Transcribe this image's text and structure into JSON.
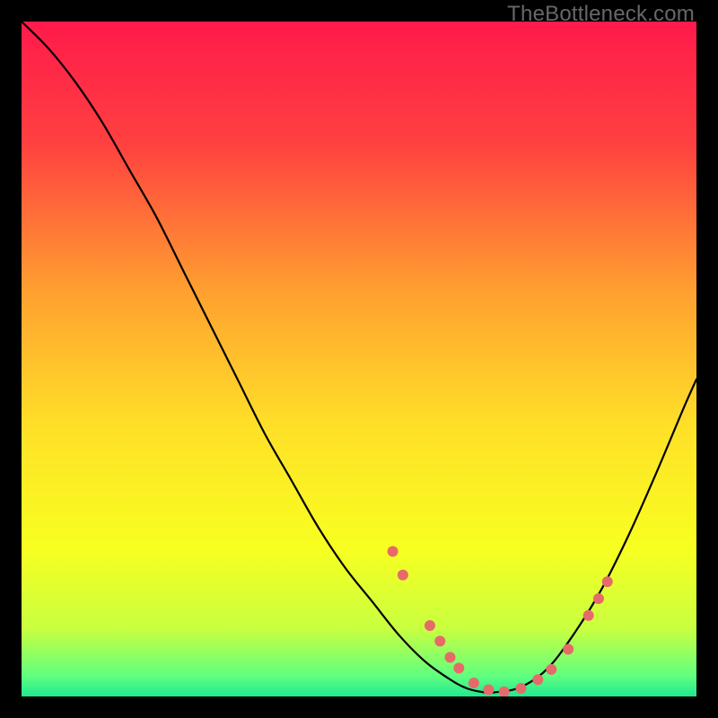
{
  "watermark": "TheBottleneck.com",
  "chart_data": {
    "type": "line",
    "title": "",
    "xlabel": "",
    "ylabel": "",
    "xlim": [
      0,
      100
    ],
    "ylim": [
      0,
      100
    ],
    "grid": false,
    "gradient_stops": [
      {
        "offset": 0,
        "color": "#ff1a4b"
      },
      {
        "offset": 0.18,
        "color": "#ff4040"
      },
      {
        "offset": 0.4,
        "color": "#ffa030"
      },
      {
        "offset": 0.6,
        "color": "#ffe028"
      },
      {
        "offset": 0.78,
        "color": "#f8ff20"
      },
      {
        "offset": 0.9,
        "color": "#c8ff40"
      },
      {
        "offset": 0.97,
        "color": "#60ff80"
      },
      {
        "offset": 1.0,
        "color": "#20e890"
      }
    ],
    "series": [
      {
        "name": "bottleneck-curve",
        "color": "#000000",
        "stroke_width": 2.2,
        "x": [
          0,
          4,
          8,
          12,
          16,
          20,
          24,
          28,
          32,
          36,
          40,
          44,
          48,
          52,
          56,
          60,
          64,
          66,
          68,
          70,
          74,
          78,
          82,
          86,
          90,
          94,
          98,
          100
        ],
        "y": [
          100,
          96,
          91,
          85,
          78,
          71,
          63,
          55,
          47,
          39,
          32,
          25,
          19,
          14,
          9,
          5,
          2.2,
          1.2,
          0.7,
          0.6,
          1.4,
          4.2,
          9.5,
          16,
          24,
          33,
          42.5,
          47
        ]
      }
    ],
    "markers": {
      "name": "curve-markers",
      "color": "#e76a6a",
      "radius": 6,
      "points": [
        {
          "x": 55.0,
          "y": 21.5
        },
        {
          "x": 56.5,
          "y": 18.0
        },
        {
          "x": 60.5,
          "y": 10.5
        },
        {
          "x": 62.0,
          "y": 8.2
        },
        {
          "x": 63.5,
          "y": 5.8
        },
        {
          "x": 64.8,
          "y": 4.2
        },
        {
          "x": 67.0,
          "y": 2.0
        },
        {
          "x": 69.2,
          "y": 1.0
        },
        {
          "x": 71.5,
          "y": 0.7
        },
        {
          "x": 74.0,
          "y": 1.2
        },
        {
          "x": 76.5,
          "y": 2.5
        },
        {
          "x": 78.5,
          "y": 4.0
        },
        {
          "x": 81.0,
          "y": 7.0
        },
        {
          "x": 84.0,
          "y": 12.0
        },
        {
          "x": 85.5,
          "y": 14.5
        },
        {
          "x": 86.8,
          "y": 17.0
        }
      ]
    }
  }
}
